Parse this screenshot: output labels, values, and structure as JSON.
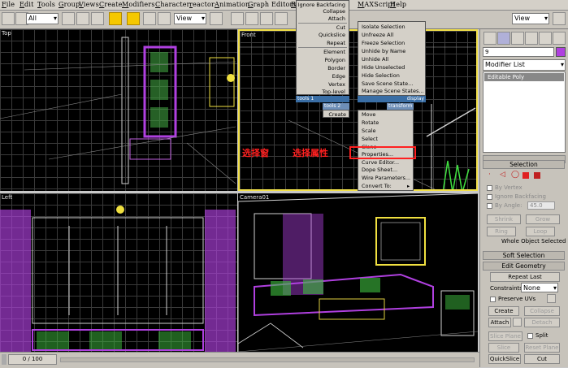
{
  "menubar": {
    "items": [
      "File",
      "Edit",
      "Tools",
      "Group",
      "Views",
      "Create",
      "Modifiers",
      "Character",
      "reactor",
      "Animation",
      "Graph Editors",
      "R",
      "MAXScript",
      "Help"
    ]
  },
  "toolbar": {
    "filter_select": "All",
    "view_select_left": "View",
    "view_select_right": "View"
  },
  "viewports": {
    "top": {
      "label": "Top"
    },
    "front": {
      "label": "Front"
    },
    "left": {
      "label": "Left"
    },
    "camera": {
      "label": "Camera01"
    }
  },
  "quad_menu_left": {
    "items": [
      "Ignore Backfacing",
      "Collapse",
      "Attach",
      "Cut",
      "Quickslice",
      "Repeat",
      "Element",
      "Polygon",
      "Border",
      "Edge",
      "Vertex",
      "Top-level"
    ],
    "footer": "tools 1",
    "footer2": "tools 2",
    "create": "Create"
  },
  "quad_menu_right": {
    "items": [
      "Isolate Selection",
      "Unfreeze All",
      "Freeze Selection",
      "Unhide by Name",
      "Unhide All",
      "Hide Unselected",
      "Hide Selection",
      "Save Scene State...",
      "Manage Scene States..."
    ],
    "header_display": "display",
    "header_transform": "transform",
    "transform_items": [
      "Move",
      "Rotate",
      "Scale",
      "Select",
      "Clone",
      "Properties...",
      "Curve Editor...",
      "Dope Sheet...",
      "Wire Parameters...",
      "Convert To:"
    ]
  },
  "annotation": {
    "text1": "选择窗",
    "text2": "选择属性"
  },
  "panel": {
    "name_field": "9",
    "modifier_list": "Modifier List",
    "stack_item": "Editable Poly",
    "selection_title": "Selection",
    "by_vertex": "By Vertex",
    "ignore_backfacing": "Ignore Backfacing",
    "by_angle": "By Angle:",
    "angle_value": "45.0",
    "shrink": "Shrink",
    "grow": "Grow",
    "ring": "Ring",
    "loop": "Loop",
    "whole_object": "Whole Object Selected",
    "soft_selection": "Soft Selection",
    "edit_geometry": "Edit Geometry",
    "repeat_last": "Repeat Last",
    "constraints": "Constraints:",
    "constraints_value": "None",
    "preserve_uvs": "Preserve UVs",
    "create": "Create",
    "collapse": "Collapse",
    "attach": "Attach",
    "detach": "Detach",
    "slice_plane": "Slice Plane",
    "split": "Split",
    "slice": "Slice",
    "reset_plane": "Reset Plane",
    "quickslice": "QuickSlice",
    "cut": "Cut"
  },
  "status": {
    "frame": "0 / 100"
  },
  "colors": {
    "active_border": "#f2e04a",
    "object_purple": "#b040e0",
    "object_green": "#40e040",
    "annotation_red": "#ff2020"
  }
}
